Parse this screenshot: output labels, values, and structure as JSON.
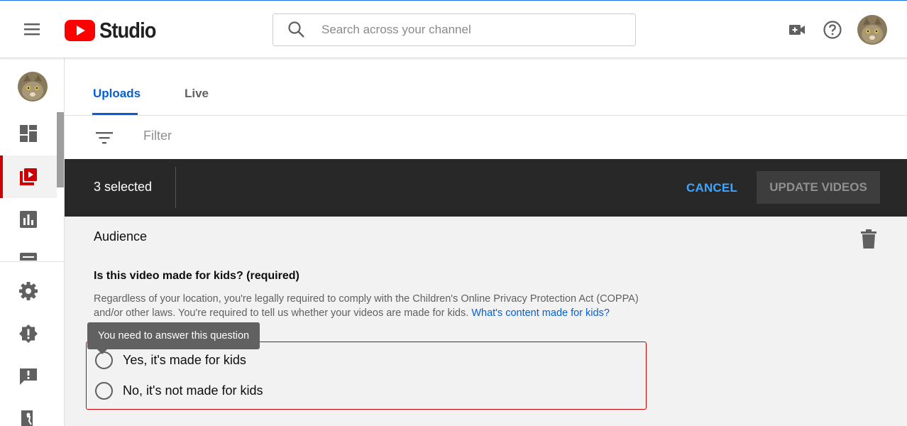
{
  "app": {
    "logo_text": "Studio"
  },
  "header": {
    "search_placeholder": "Search across your channel"
  },
  "tabs": [
    {
      "label": "Uploads"
    },
    {
      "label": "Live"
    }
  ],
  "filter": {
    "placeholder": "Filter"
  },
  "selection_bar": {
    "count_text": "3 selected",
    "cancel_label": "CANCEL",
    "update_label": "UPDATE VIDEOS"
  },
  "audience": {
    "title": "Audience",
    "question": "Is this video made for kids? (required)",
    "description": "Regardless of your location, you're legally required to comply with the Children's Online Privacy Protection Act (COPPA) and/or other laws. You're required to tell us whether your videos are made for kids.",
    "link_text": "What's content made for kids?",
    "tooltip": "You need to answer this question",
    "options": [
      {
        "label": "Yes, it's made for kids"
      },
      {
        "label": "No, it's not made for kids"
      }
    ]
  },
  "colors": {
    "accent": "#065fd4",
    "brand_red": "#ff0000",
    "error_red": "#cc0000",
    "dark_bar": "#282828",
    "cancel_blue": "#3ea6ff"
  }
}
